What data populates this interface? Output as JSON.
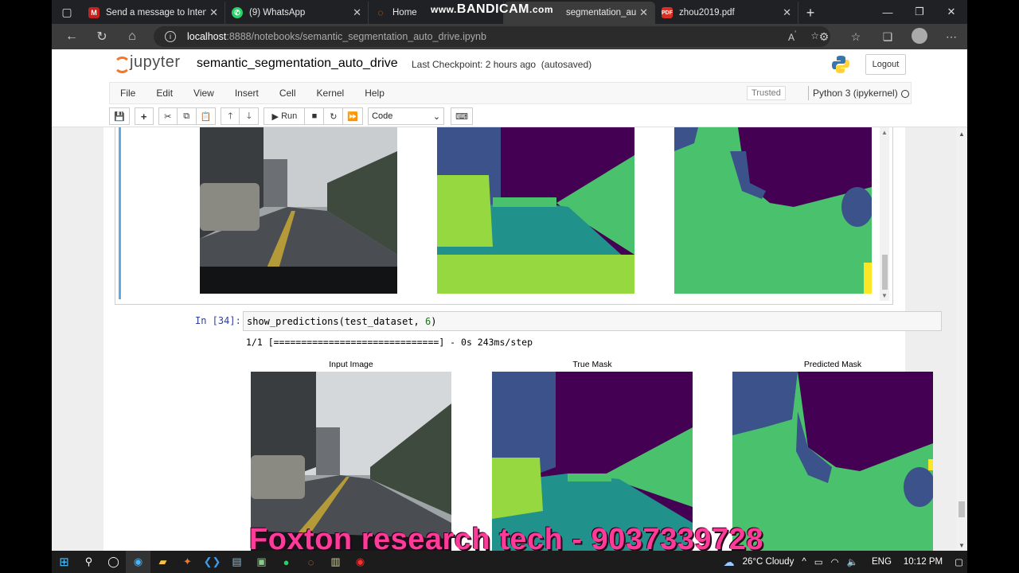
{
  "browser": {
    "tabs": [
      {
        "title": "Send a message to Intense",
        "icon": "gmail-icon",
        "color": "#c5221f",
        "active": false
      },
      {
        "title": "(9) WhatsApp",
        "icon": "whatsapp-icon",
        "color": "#25d366",
        "active": false
      },
      {
        "title": "Home",
        "icon": "jupyter-icon",
        "color": "#f37726",
        "active": false
      },
      {
        "title": "segmentation_au",
        "icon": "jupyter-icon",
        "color": "#f37726",
        "active": true
      },
      {
        "title": "zhou2019.pdf",
        "icon": "pdf-icon",
        "color": "#d93025",
        "active": false
      }
    ],
    "recording_watermark_prefix": "www.",
    "recording_watermark": "BANDICAM",
    "recording_watermark_suffix": ".com",
    "url_host": "localhost",
    "url_path": ":8888/notebooks/semantic_segmentation_auto_drive.ipynb"
  },
  "jupyter": {
    "logo_text": "jupyter",
    "notebook_name": "semantic_segmentation_auto_drive",
    "checkpoint": "Last Checkpoint: 2 hours ago",
    "autosave": "(autosaved)",
    "logout_label": "Logout",
    "menu": [
      "File",
      "Edit",
      "View",
      "Insert",
      "Cell",
      "Kernel",
      "Help"
    ],
    "trusted_label": "Trusted",
    "kernel_label": "Python 3 (ipykernel)",
    "run_label": "Run",
    "cell_type": "Code"
  },
  "notebook": {
    "prompt": "In [34]:",
    "code_fn": "show_predictions(test_dataset, ",
    "code_num": "6",
    "code_close": ")",
    "output_line": "1/1 [==============================] - 0s 243ms/step",
    "captions": {
      "input": "Input Image",
      "true_mask": "True Mask",
      "predicted": "Predicted Mask"
    }
  },
  "overlay": {
    "watermark": "Foxton research tech - 9037339728"
  },
  "taskbar": {
    "weather": "26°C Cloudy",
    "lang": "ENG",
    "time": "10:12 PM"
  },
  "colors": {
    "mask_purple": "#440154",
    "mask_darkblue": "#3b528b",
    "mask_teal": "#21918c",
    "mask_green": "#4ac16d",
    "mask_lime": "#95d840",
    "mask_yellow": "#fde725",
    "watermark": "#ff3b9a"
  }
}
